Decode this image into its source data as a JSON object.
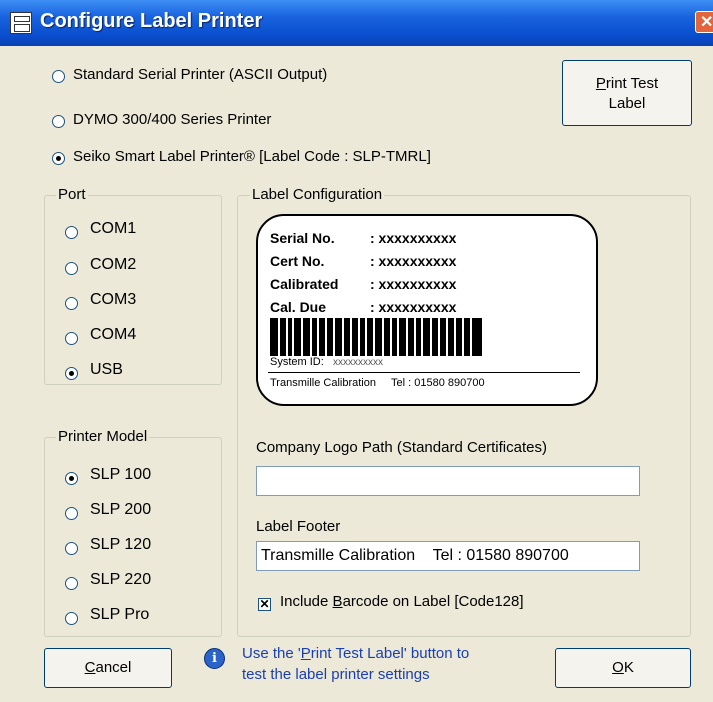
{
  "window": {
    "title": "Configure Label Printer",
    "close_glyph": "✕",
    "app_icon": "label-printer-icon"
  },
  "printer_type": {
    "options": [
      {
        "label": "Standard Serial Printer (ASCII Output)",
        "selected": false
      },
      {
        "label": "DYMO 300/400 Series Printer",
        "selected": false
      },
      {
        "label": "Seiko Smart Label Printer® [Label Code : SLP-TMRL]",
        "selected": true
      }
    ]
  },
  "print_test_button": {
    "line1_prefix": "",
    "line1_ul": "P",
    "line1_rest": "rint Test",
    "line2": "Label"
  },
  "port": {
    "legend": "Port",
    "options": [
      {
        "label": "COM1",
        "selected": false
      },
      {
        "label": "COM2",
        "selected": false
      },
      {
        "label": "COM3",
        "selected": false
      },
      {
        "label": "COM4",
        "selected": false
      },
      {
        "label": "USB",
        "selected": true
      }
    ]
  },
  "printer_model": {
    "legend": "Printer Model",
    "options": [
      {
        "label": "SLP 100",
        "selected": true
      },
      {
        "label": "SLP 200",
        "selected": false
      },
      {
        "label": "SLP 120",
        "selected": false
      },
      {
        "label": "SLP 220",
        "selected": false
      },
      {
        "label": "SLP Pro",
        "selected": false
      }
    ]
  },
  "label_config": {
    "legend": "Label Configuration",
    "preview": {
      "rows": [
        {
          "key": "Serial No.",
          "value": ": xxxxxxxxxx"
        },
        {
          "key": "Cert No.",
          "value": ": xxxxxxxxxx"
        },
        {
          "key": "Calibrated",
          "value": ": xxxxxxxxxx"
        },
        {
          "key": "Cal. Due",
          "value": ": xxxxxxxxxx"
        }
      ],
      "system_id_label": "System ID:",
      "system_id_value": "xxxxxxxxxx",
      "footer": "Transmille Calibration     Tel : 01580 890700"
    },
    "logo_path": {
      "label": "Company Logo Path (Standard Certificates)",
      "value": ""
    },
    "label_footer": {
      "label": "Label Footer",
      "value": "Transmille Calibration    Tel : 01580 890700"
    },
    "barcode_checkbox": {
      "label_prefix": "Include ",
      "label_ul": "B",
      "label_rest": "arcode on Label [Code128]",
      "checked": true
    }
  },
  "cancel_button": {
    "ul": "C",
    "rest": "ancel"
  },
  "ok_button": {
    "ul": "O",
    "rest": "K"
  },
  "info": {
    "icon": "info-icon",
    "line1_prefix": "Use the '",
    "line1_ul": "P",
    "line1_rest": "rint Test Label' button to",
    "line2": "test the label printer settings"
  },
  "colors": {
    "titlebar": "#0a4fcf",
    "dialog_bg": "#ece9d8",
    "info_text": "#1a3fb1"
  }
}
